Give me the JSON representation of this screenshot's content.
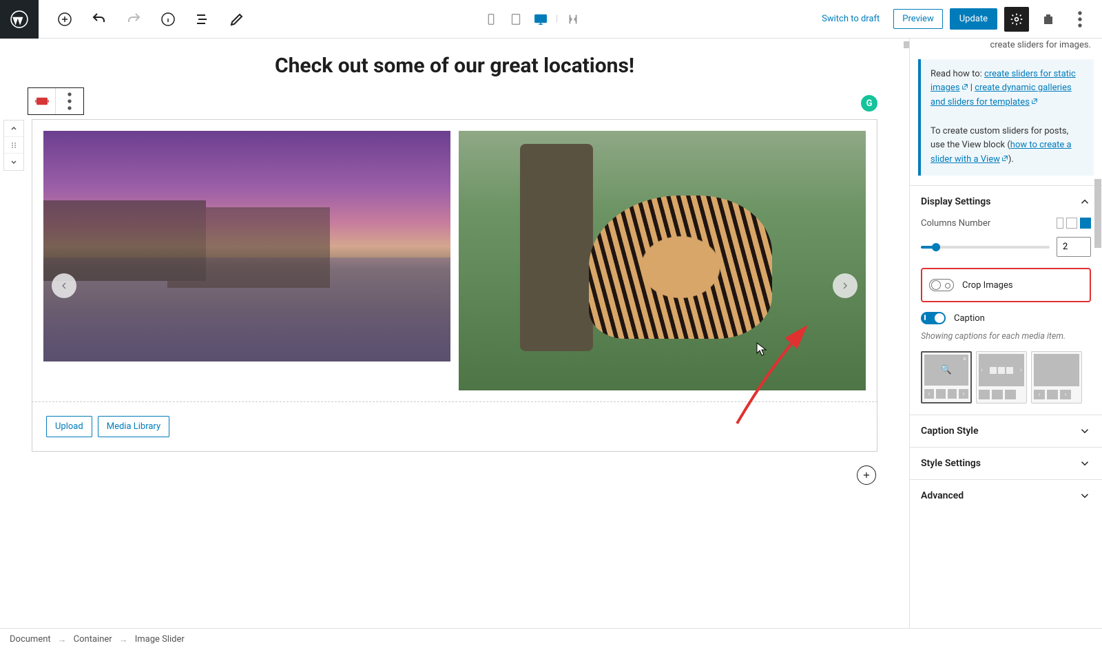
{
  "toolbar": {
    "switch_to_draft": "Switch to draft",
    "preview": "Preview",
    "update": "Update"
  },
  "heading": "Check out some of our great locations!",
  "upload": {
    "upload_label": "Upload",
    "media_library_label": "Media Library"
  },
  "sidebar": {
    "intro_tail": "create sliders for images.",
    "info": {
      "read_how_to": "Read how to: ",
      "link_static": "create sliders for static images",
      "link_dynamic": "create dynamic galleries and sliders for templates",
      "sep": " | ",
      "custom_pre": "To create custom sliders for posts, use the View block (",
      "link_view": "how to create a slider with a View",
      "custom_post": ")."
    },
    "display_settings": {
      "title": "Display Settings",
      "columns_label": "Columns Number",
      "columns_value": "2",
      "crop_label": "Crop Images",
      "caption_label": "Caption",
      "caption_help": "Showing captions for each media item."
    },
    "caption_style": "Caption Style",
    "style_settings": "Style Settings",
    "advanced": "Advanced"
  },
  "breadcrumb": {
    "doc": "Document",
    "container": "Container",
    "slider": "Image Slider"
  }
}
